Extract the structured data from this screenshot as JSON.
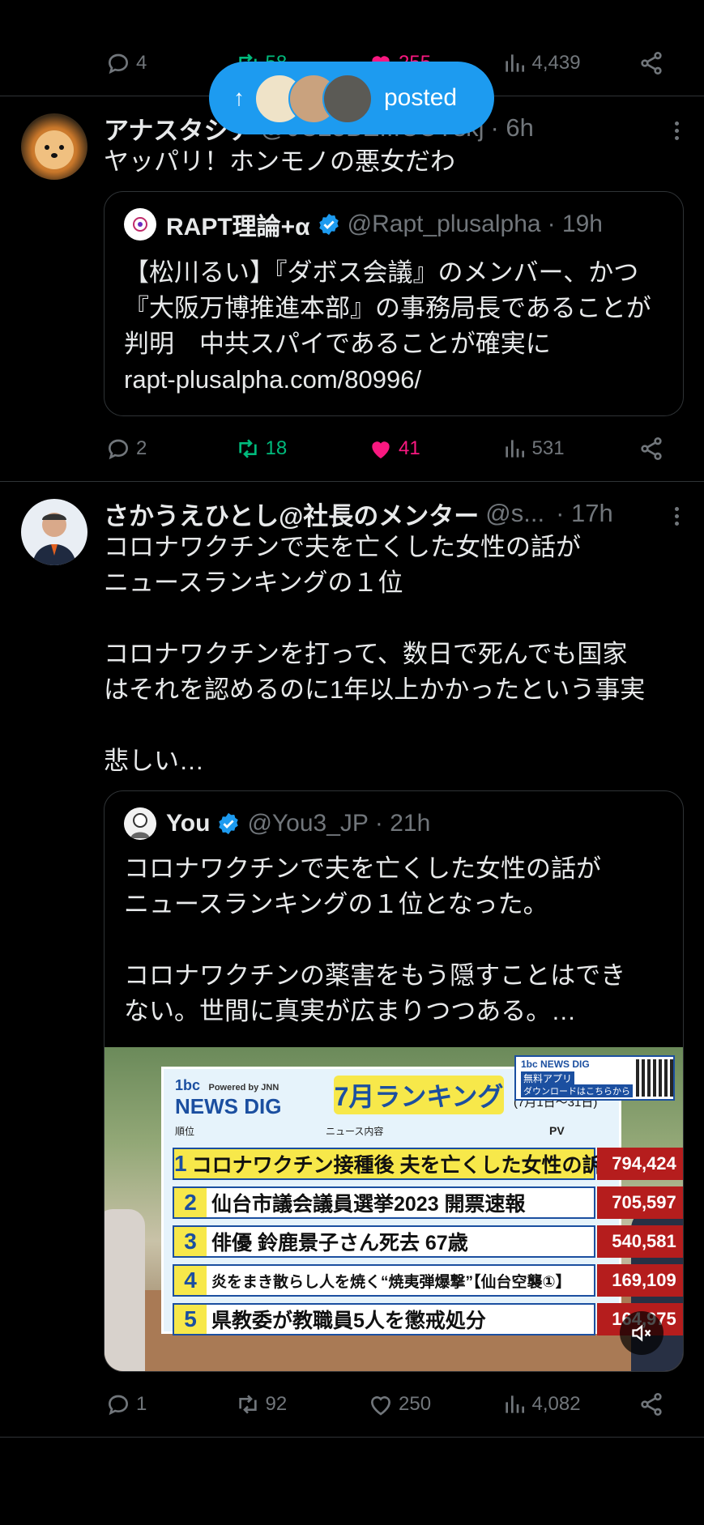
{
  "top_bar": {
    "replies": "4",
    "retweets": "58",
    "likes": "255",
    "views": "4,439"
  },
  "new_posts_pill": {
    "label": "posted"
  },
  "tweet1": {
    "author_name": "アナスタシア",
    "handle": "@0C25BE...CCYskj",
    "time": "· 6h",
    "text": "ヤッパリ！ホンモノの悪女だわ",
    "quote": {
      "author_name": "RAPT理論+α",
      "handle": "@Rapt_plusalpha",
      "time": "· 19h",
      "text": "【松川るい】『ダボス会議』のメンバー、かつ『大阪万博推進本部』の事務局長であることが判明　中共スパイであることが確実に",
      "link": "rapt-plusalpha.com/80996/"
    },
    "replies": "2",
    "retweets": "18",
    "likes": "41",
    "views": "531"
  },
  "tweet2": {
    "author_name": "さかうえひとし@社長のメンター",
    "handle": "@s...",
    "time": "· 17h",
    "text": "コロナワクチンで夫を亡くした女性の話が\nニュースランキングの１位\n\nコロナワクチンを打って、数日で死んでも国家\nはそれを認めるのに1年以上かかったという事実\n\n悲しい…",
    "quote": {
      "author_name": "You",
      "handle": "@You3_JP",
      "time": "· 21h",
      "text": "コロナワクチンで夫を亡くした女性の話が\nニュースランキングの１位となった。\n\nコロナワクチンの薬害をもう隠すことはでき\nない。世間に真実が広まりつつある。…",
      "media": {
        "brand": "NEWS DIG",
        "brand_prefix": "1bc",
        "powered": "Powered by JNN",
        "title": "7月ランキング",
        "period": "(7月1日〜31日)",
        "app_note_1": "無料アプリ",
        "app_note_2": "ダウンロードはこちらから",
        "col_rank": "順位",
        "col_content": "ニュース内容",
        "col_pv": "PV",
        "rows": [
          {
            "rank": "1",
            "text": "コロナワクチン接種後 夫を亡くした女性の訴え",
            "pv": "794,424"
          },
          {
            "rank": "2",
            "text": "仙台市議会議員選挙2023 開票速報",
            "pv": "705,597"
          },
          {
            "rank": "3",
            "text": "俳優 鈴鹿景子さん死去 67歳",
            "pv": "540,581"
          },
          {
            "rank": "4",
            "text": "炎をまき散らし人を焼く“焼夷弾爆撃”【仙台空襲①】",
            "pv": "169,109"
          },
          {
            "rank": "5",
            "text": "県教委が教職員5人を懲戒処分",
            "pv": "164,975"
          }
        ]
      }
    },
    "replies": "1",
    "retweets": "92",
    "likes": "250",
    "views": "4,082"
  },
  "colors": {
    "bg": "#000000",
    "text": "#e7e9ea",
    "muted": "#71767b",
    "retweet": "#00ba7c",
    "like": "#f91880",
    "accent": "#1d9bf0"
  }
}
